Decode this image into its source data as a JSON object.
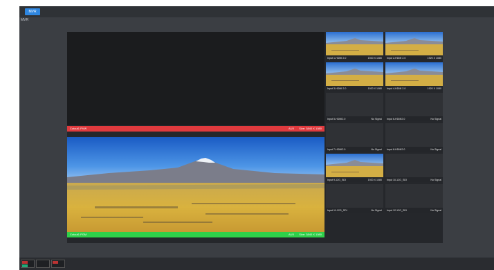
{
  "topbar": {
    "mvr_button": "MVR"
  },
  "page_label": "MVR",
  "preview_bar": {
    "left": "Cutout1 PVW",
    "aux": "AUX",
    "res": "Size: 3840 X 1080"
  },
  "program_bar": {
    "left": "Cutout1 PGM",
    "aux": "AUX",
    "res": "Size: 3840 X 1080"
  },
  "tiles": [
    {
      "name": "Input 1-HDMI 2.0",
      "status": "1920 X 1080",
      "signal": true
    },
    {
      "name": "Input 2-HDMI 2.0",
      "status": "1920 X 1080",
      "signal": true
    },
    {
      "name": "Input 3-HDMI 2.0",
      "status": "1920 X 1080",
      "signal": true
    },
    {
      "name": "Input 4-HDMI 2.0",
      "status": "1920 X 1080",
      "signal": true
    },
    {
      "name": "Input 5-HDMI2.0",
      "status": "No Signal",
      "signal": false
    },
    {
      "name": "Input 6-HDMI2.0",
      "status": "No Signal",
      "signal": false
    },
    {
      "name": "Input 7-HDMI2.0",
      "status": "No Signal",
      "signal": false
    },
    {
      "name": "Input 8-HDMI2.0",
      "status": "No Signal",
      "signal": false
    },
    {
      "name": "Input 9-12G_SDI",
      "status": "1920 X 1080",
      "signal": true
    },
    {
      "name": "Input 10-12G_SDI",
      "status": "No Signal",
      "signal": false
    },
    {
      "name": "Input 11-12G_SDI",
      "status": "No Signal",
      "signal": false
    },
    {
      "name": "Input 12-12G_SDI",
      "status": "No Signal",
      "signal": false
    }
  ],
  "colors": {
    "accent": "#2e86e0",
    "pvw_bar": "#e03a3e",
    "pgm_bar": "#2fd04a",
    "background": "#3b3e43"
  }
}
